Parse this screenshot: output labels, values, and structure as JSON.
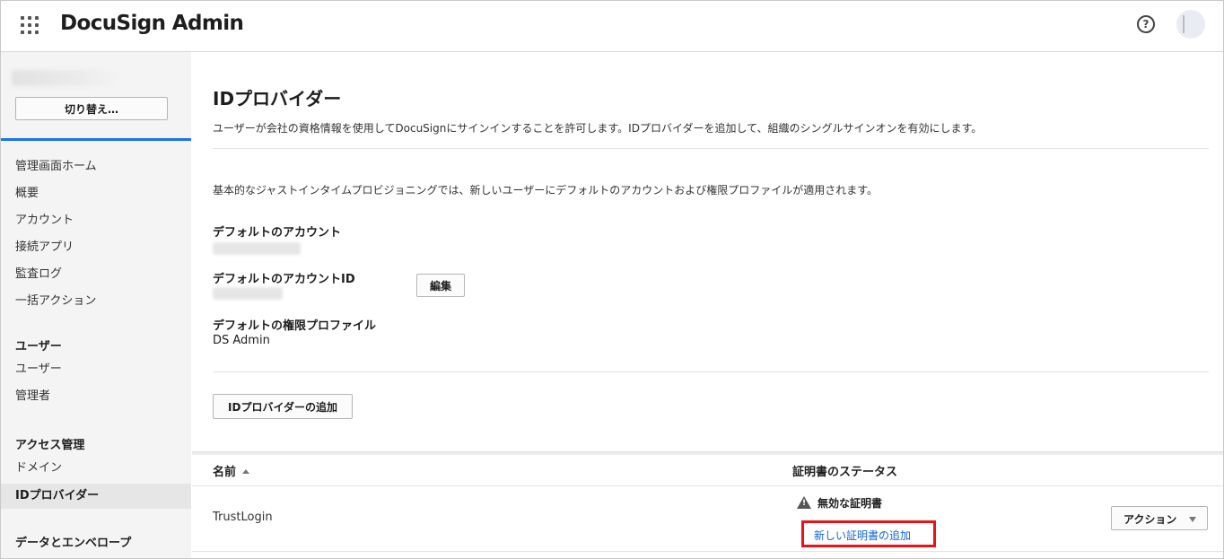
{
  "topbar": {
    "brand": "DocuSign Admin",
    "help_icon": "question-circle-icon",
    "help_glyph": "?",
    "apps_icon": "grid-icon"
  },
  "sidebar": {
    "switch_label": "切り替え…",
    "accent_color": "#1a73e8",
    "groups": [
      {
        "items": [
          "管理画面ホーム",
          "概要",
          "アカウント",
          "接続アプリ",
          "監査ログ",
          "一括アクション"
        ]
      },
      {
        "heading": "ユーザー",
        "items": [
          "ユーザー",
          "管理者"
        ]
      },
      {
        "heading": "アクセス管理",
        "items": [
          "ドメイン",
          "IDプロバイダー"
        ],
        "active": "IDプロバイダー"
      },
      {
        "heading": "データとエンベロープ"
      }
    ]
  },
  "main": {
    "title": "IDプロバイダー",
    "description": "ユーザーが会社の資格情報を使用してDocuSignにサインインすることを許可します。IDプロバイダーを追加して、組織のシングルサインオンを有効にします。",
    "jit_description": "基本的なジャストインタイムプロビジョニングでは、新しいユーザーにデフォルトのアカウントおよび権限プロファイルが適用されます。",
    "default_account_label": "デフォルトのアカウント",
    "default_account_id_label": "デフォルトのアカウントID",
    "edit_label": "編集",
    "default_profile_label": "デフォルトの権限プロファイル",
    "default_profile_value": "DS Admin",
    "add_idp_label": "IDプロバイダーの追加"
  },
  "table": {
    "columns": {
      "name": "名前",
      "status": "証明書のステータス"
    },
    "sort_icon": "sort-ascending-icon",
    "rows": [
      {
        "name": "TrustLogin",
        "status_icon": "warning-icon",
        "status": "無効な証明書",
        "add_cert_link": "新しい証明書の追加",
        "action_label": "アクション"
      }
    ],
    "highlight_color": "#e8141c",
    "link_color": "#1166d6"
  }
}
